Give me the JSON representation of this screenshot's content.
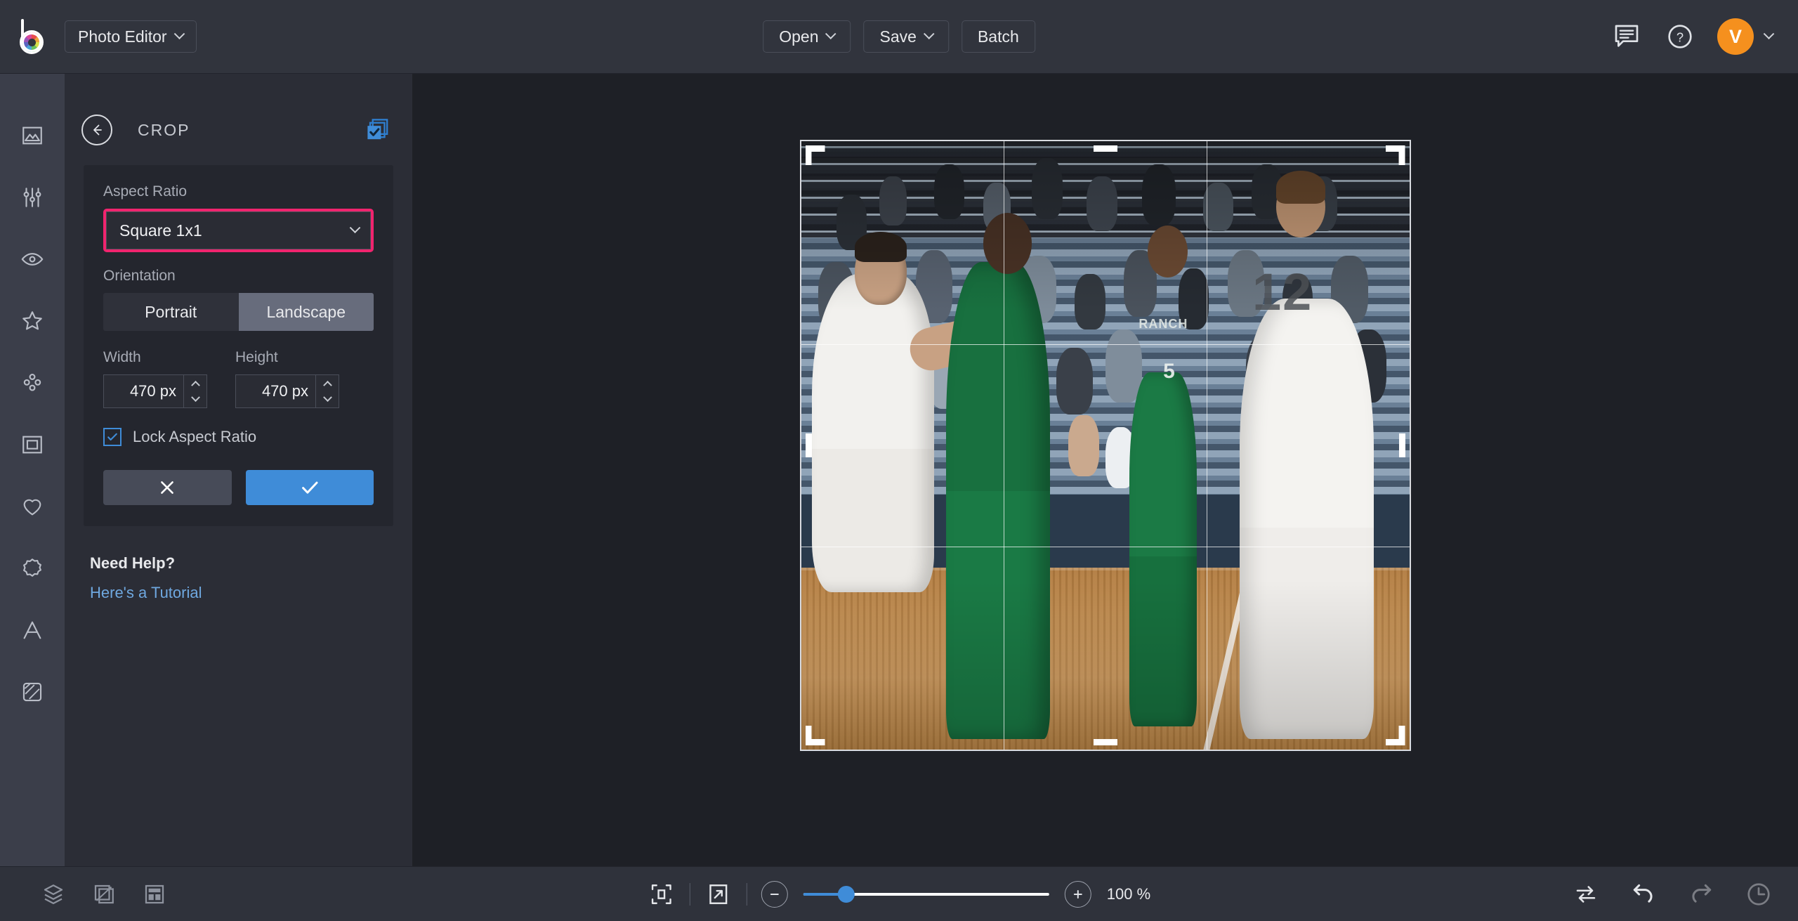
{
  "app": {
    "logo_name": "bonanza-logo",
    "app_switcher_label": "Photo Editor"
  },
  "topbar": {
    "open_label": "Open",
    "save_label": "Save",
    "batch_label": "Batch",
    "feedback_icon": "chat-icon",
    "help_icon": "help-icon",
    "avatar_initial": "V"
  },
  "rail": {
    "items": [
      {
        "name": "image-icon",
        "label": "Image"
      },
      {
        "name": "adjust-icon",
        "label": "Adjust"
      },
      {
        "name": "eye-icon",
        "label": "Effects"
      },
      {
        "name": "star-icon",
        "label": "Overlays"
      },
      {
        "name": "dots-icon",
        "label": "Textures"
      },
      {
        "name": "frame-icon",
        "label": "Frames"
      },
      {
        "name": "heart-icon",
        "label": "Stickers"
      },
      {
        "name": "badge-icon",
        "label": "Badges"
      },
      {
        "name": "text-icon",
        "label": "Text"
      },
      {
        "name": "draw-icon",
        "label": "Draw"
      }
    ]
  },
  "panel": {
    "title": "CROP",
    "back_icon": "back-arrow-icon",
    "apply_all_icon": "apply-to-all-icon",
    "aspect_ratio_label": "Aspect Ratio",
    "aspect_ratio_value": "Square 1x1",
    "orientation_label": "Orientation",
    "orientation_portrait": "Portrait",
    "orientation_landscape": "Landscape",
    "orientation_selected": "Landscape",
    "width_label": "Width",
    "width_value": "470 px",
    "height_label": "Height",
    "height_value": "470 px",
    "lock_label": "Lock Aspect Ratio",
    "lock_checked": true,
    "cancel_icon": "close-icon",
    "apply_icon": "check-icon",
    "help_title": "Need Help?",
    "help_link": "Here's a Tutorial",
    "highlight_color": "#f0246e",
    "accent_color": "#3f8cd8"
  },
  "canvas": {
    "image_description": "High school basketball game, players on wooden court in front of blue bleachers",
    "jersey_number_large": "12",
    "jersey_number_small": "5",
    "jersey_team_word": "RANCH",
    "crop_grid": "rule-of-thirds"
  },
  "bottombar": {
    "layers_icon": "layers-icon",
    "compare_icon": "compare-icon",
    "layout_icon": "layout-icon",
    "fit_icon": "fit-to-screen-icon",
    "fullscreen_icon": "expand-icon",
    "zoom_out_icon": "minus-icon",
    "zoom_in_icon": "plus-icon",
    "zoom_value": "100 %",
    "zoom_percent": 100,
    "swap_icon": "swap-icon",
    "undo_icon": "undo-icon",
    "redo_icon": "redo-icon",
    "history_icon": "history-icon"
  }
}
